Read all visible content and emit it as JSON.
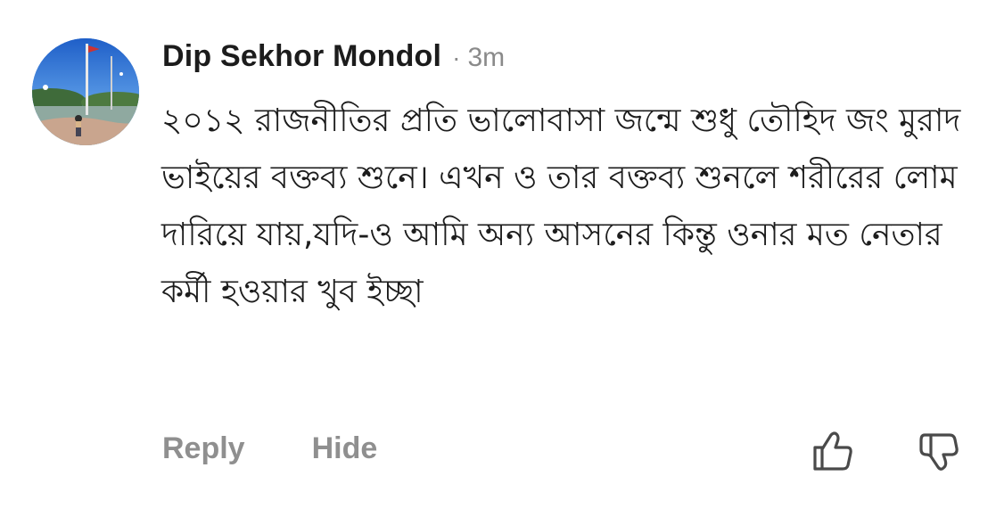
{
  "comment": {
    "author": "Dip Sekhor Mondol",
    "separator": "·",
    "time": "3m",
    "text": "২০১২ রাজনীতির প্রতি ভালোবাসা জন্মে শুধু তৌহিদ জং মুরাদ ভাইয়ের বক্তব্য শুনে। এখন ও তার বক্তব্য শুনলে শরীরের লোম দারিয়ে যায়,যদি-ও আমি অন্য আসনের কিন্তু ওনার মত নেতার কর্মী হওয়ার খুব ইচ্ছা"
  },
  "actions": {
    "reply_label": "Reply",
    "hide_label": "Hide"
  },
  "icons": {
    "upvote": "thumbs-up-icon",
    "downvote": "thumbs-down-icon",
    "avatar": "profile-photo"
  },
  "colors": {
    "text": "#1c1c1c",
    "muted": "#8a8a8a",
    "action": "#8f8f8f"
  }
}
